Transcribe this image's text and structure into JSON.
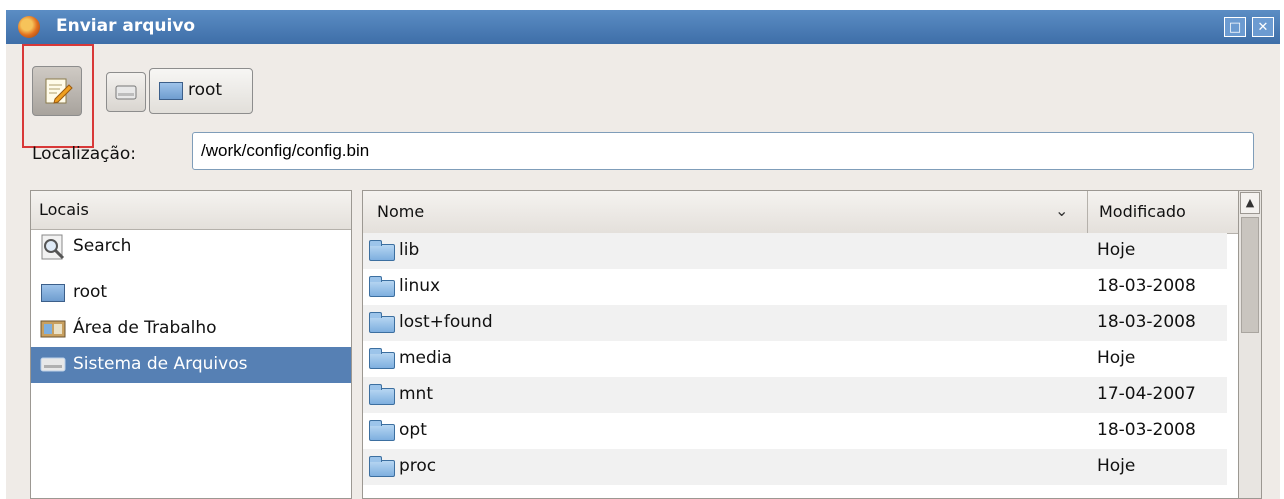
{
  "window": {
    "title": "Enviar arquivo"
  },
  "toolbar": {
    "path_button_label": "root"
  },
  "location": {
    "label": "Localização:",
    "value": "/work/config/config.bin"
  },
  "places": {
    "header": "Locais",
    "items": [
      {
        "label": "Search",
        "icon": "search-icon",
        "selected": false
      },
      {
        "label": "root",
        "icon": "home-folder-icon",
        "selected": false
      },
      {
        "label": "Área de Trabalho",
        "icon": "desktop-icon",
        "selected": false
      },
      {
        "label": "Sistema de Arquivos",
        "icon": "drive-icon",
        "selected": true
      }
    ]
  },
  "files": {
    "columns": {
      "name": "Nome",
      "modified": "Modificado"
    },
    "rows": [
      {
        "name": "lib",
        "modified": "Hoje"
      },
      {
        "name": "linux",
        "modified": "18-03-2008"
      },
      {
        "name": "lost+found",
        "modified": "18-03-2008"
      },
      {
        "name": "media",
        "modified": "Hoje"
      },
      {
        "name": "mnt",
        "modified": "17-04-2007"
      },
      {
        "name": "opt",
        "modified": "18-03-2008"
      },
      {
        "name": "proc",
        "modified": "Hoje"
      }
    ]
  },
  "colors": {
    "titlebar": "#3e6ea8",
    "selection": "#5680b4",
    "highlight_box": "#d83838"
  }
}
